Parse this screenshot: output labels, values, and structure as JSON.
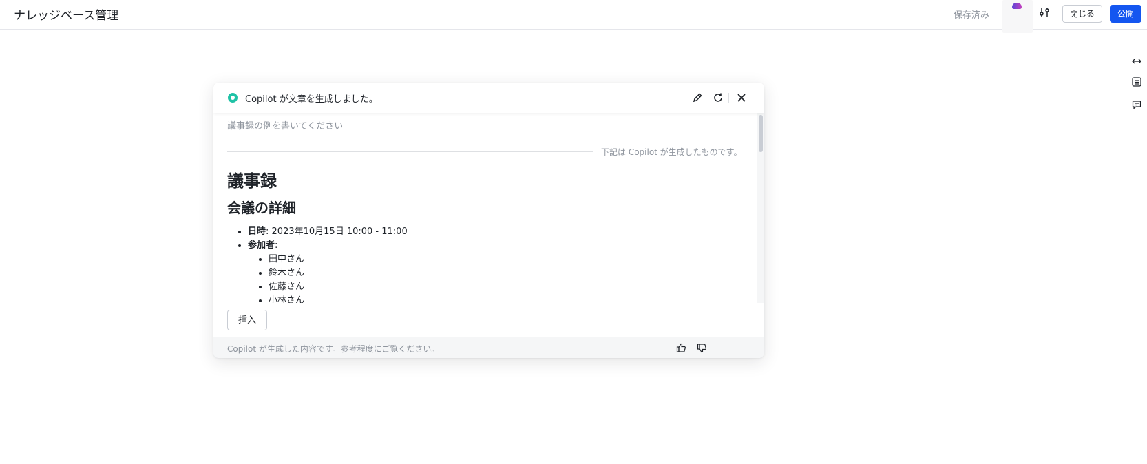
{
  "header": {
    "title": "ナレッジベース管理",
    "saved_status": "保存済み",
    "settings_icon": "sliders-icon",
    "close_label": "閉じる",
    "publish_label": "公開",
    "publish_color": "#1456f0"
  },
  "right_rail": {
    "icons": [
      "expand-width-icon",
      "table-of-contents-icon",
      "comment-icon"
    ]
  },
  "copilot": {
    "status_color": "#1fc2a6",
    "title": "Copilot が文章を生成しました。",
    "head_icons": [
      "edit-icon",
      "refresh-icon",
      "close-icon"
    ],
    "prompt": "議事録の例を書いてください",
    "divider_text": "下記は Copilot が生成したものです。",
    "document": {
      "h1": "議事録",
      "h2": "会議の詳細",
      "datetime_label": "日時",
      "datetime_value": ": 2023年10月15日 10:00 - 11:00",
      "attendees_label": "参加者",
      "attendees_suffix": ":",
      "attendees": [
        "田中さん",
        "鈴木さん",
        "佐藤さん",
        "小林さん"
      ]
    },
    "insert_label": "挿入",
    "footer_text": "Copilot が生成した内容です。参考程度にご覧ください。",
    "footer_icons": [
      "thumbs-up-icon",
      "thumbs-down-icon"
    ]
  }
}
